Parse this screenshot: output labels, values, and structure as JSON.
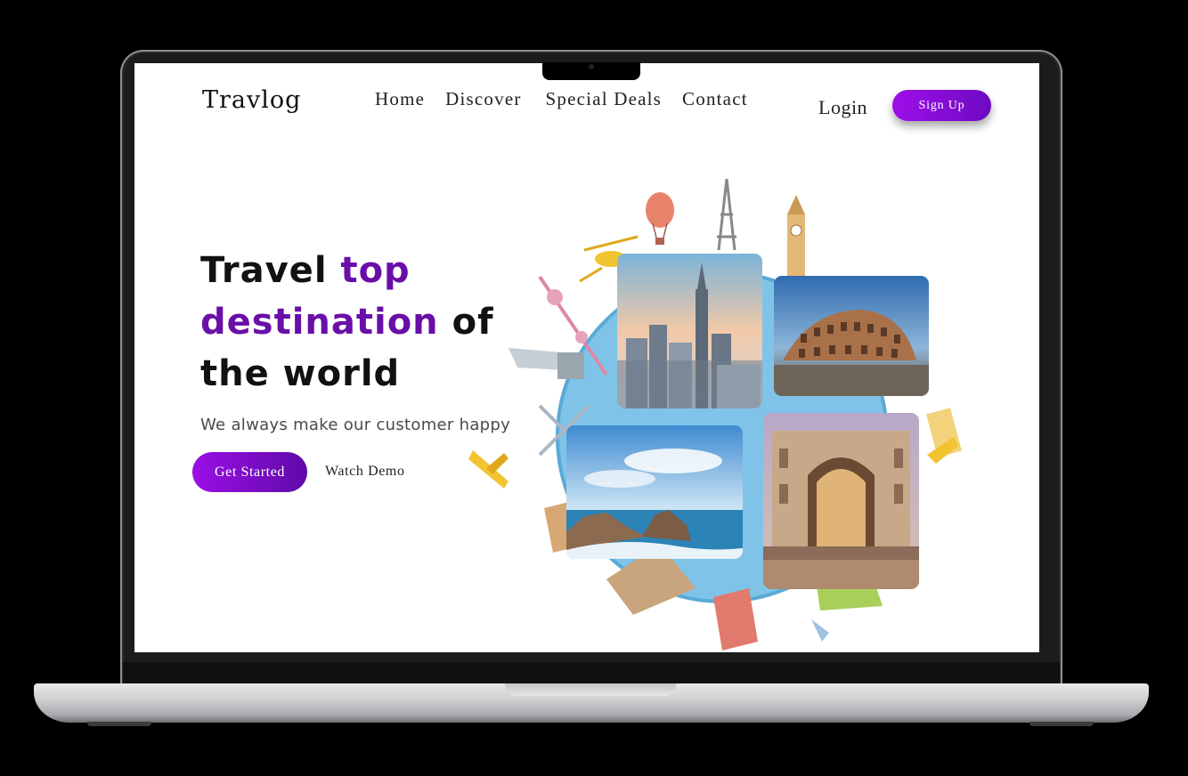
{
  "brand": {
    "logo": "Travlog",
    "accent_color": "#6a0ea8",
    "button_gradient": [
      "#9d0fe8",
      "#6d0ac2"
    ]
  },
  "nav": {
    "items": [
      "Home",
      "Discover",
      "Special Deals",
      "Contact"
    ],
    "login": "Login",
    "signup": "Sign Up"
  },
  "hero": {
    "title_part1": "Travel ",
    "title_highlight": "top destination",
    "title_part2": " of the world",
    "subtitle": "We always make our customer happy",
    "cta_primary": "Get Started",
    "cta_secondary": "Watch Demo"
  },
  "images": [
    {
      "name": "new-york-skyline"
    },
    {
      "name": "colosseum"
    },
    {
      "name": "coastal-rocks"
    },
    {
      "name": "galleria-milan"
    }
  ]
}
